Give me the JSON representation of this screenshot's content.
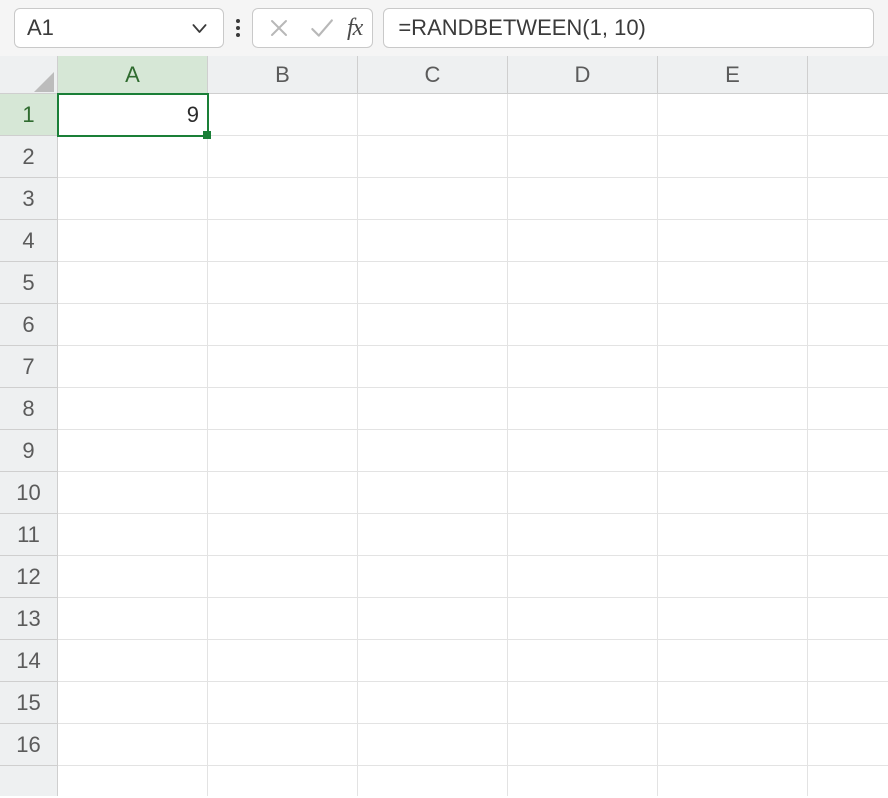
{
  "namebox": {
    "value": "A1"
  },
  "fx": {
    "label": "fx"
  },
  "formula": {
    "value": "=RANDBETWEEN(1, 10)"
  },
  "columns": [
    "A",
    "B",
    "C",
    "D",
    "E"
  ],
  "rows": [
    "1",
    "2",
    "3",
    "4",
    "5",
    "6",
    "7",
    "8",
    "9",
    "10",
    "11",
    "12",
    "13",
    "14",
    "15",
    "16"
  ],
  "active": {
    "col": "A",
    "row": "1"
  },
  "cells": {
    "A1": "9"
  }
}
